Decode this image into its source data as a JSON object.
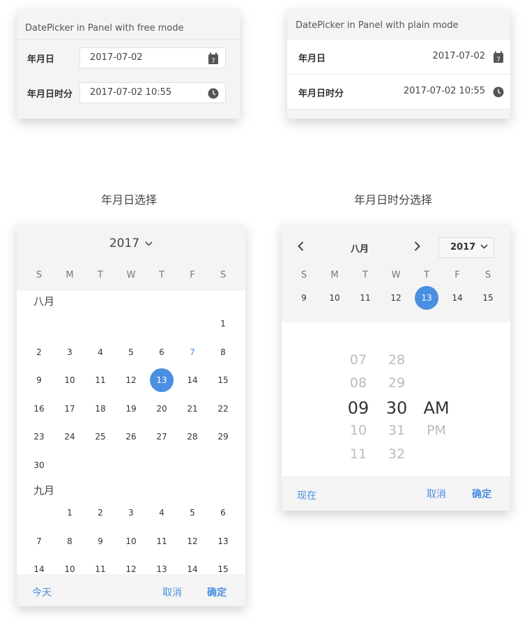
{
  "free_mode": {
    "title": "DatePicker in Panel with free mode",
    "rows": [
      {
        "label": "年月日",
        "value": "2017-07-02",
        "icon": "calendar-icon",
        "icon_day": "7"
      },
      {
        "label": "年月日时分",
        "value": "2017-07-02 10:55",
        "icon": "clock-icon"
      }
    ]
  },
  "plain_mode": {
    "title": "DatePicker in Panel with plain mode",
    "rows": [
      {
        "label": "年月日",
        "value": "2017-07-02",
        "icon": "calendar-icon",
        "icon_day": "7"
      },
      {
        "label": "年月日时分",
        "value": "2017-07-02 10:55",
        "icon": "clock-icon"
      }
    ]
  },
  "headings": {
    "date_select": "年月日选择",
    "datetime_select": "年月日时分选择"
  },
  "date_panel": {
    "year": "2017",
    "weekdays": [
      "S",
      "M",
      "T",
      "W",
      "T",
      "F",
      "S"
    ],
    "months": [
      {
        "label": "八月",
        "weeks": [
          [
            "",
            "",
            "",
            "",
            "",
            "",
            "1"
          ],
          [
            "2",
            "3",
            "4",
            "5",
            "6",
            "7",
            "8"
          ],
          [
            "9",
            "10",
            "11",
            "12",
            "13",
            "14",
            "15"
          ],
          [
            "16",
            "17",
            "18",
            "19",
            "20",
            "21",
            "22"
          ],
          [
            "23",
            "24",
            "25",
            "26",
            "27",
            "28",
            "29"
          ],
          [
            "30",
            "",
            "",
            "",
            "",
            "",
            ""
          ]
        ]
      },
      {
        "label": "九月",
        "weeks": [
          [
            "",
            "1",
            "2",
            "3",
            "4",
            "5",
            "6"
          ],
          [
            "7",
            "8",
            "9",
            "10",
            "11",
            "12",
            "13"
          ],
          [
            "14",
            "10",
            "11",
            "12",
            "13",
            "14",
            "15"
          ]
        ]
      }
    ],
    "selected_day": "13",
    "highlight_day": "7",
    "footer": {
      "today": "今天",
      "cancel": "取消",
      "confirm": "确定"
    }
  },
  "datetime_panel": {
    "month": "八月",
    "year": "2017",
    "weekdays": [
      "S",
      "M",
      "T",
      "W",
      "T",
      "F",
      "S"
    ],
    "week": [
      "9",
      "10",
      "11",
      "12",
      "13",
      "14",
      "15"
    ],
    "selected_day": "13",
    "hours": [
      "07",
      "08",
      "09",
      "10",
      "11"
    ],
    "minutes": [
      "28",
      "29",
      "30",
      "31",
      "32"
    ],
    "ampm": [
      "AM",
      "PM"
    ],
    "selected_hour": "09",
    "selected_minute": "30",
    "selected_ampm": "AM",
    "footer": {
      "now": "现在",
      "cancel": "取消",
      "confirm": "确定"
    }
  },
  "colors": {
    "accent": "#4a8fe0",
    "panel_bg": "#f4f4f4"
  }
}
